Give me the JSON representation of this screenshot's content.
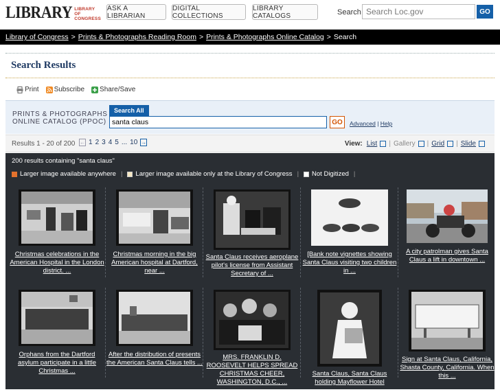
{
  "header": {
    "logo_text": "LIBRARY",
    "logo_sub": "LIBRARY OF CONGRESS",
    "buttons": [
      "ASK A LIBRARIAN",
      "DIGITAL COLLECTIONS",
      "LIBRARY CATALOGS"
    ],
    "search_label": "Search",
    "search_placeholder": "Search Loc.gov",
    "go": "GO"
  },
  "breadcrumb": {
    "items": [
      "Library of Congress",
      "Prints & Photographs Reading Room",
      "Prints & Photographs Online Catalog"
    ],
    "current": "Search",
    "sep": ">"
  },
  "page_title": "Search Results",
  "tools": {
    "print": "Print",
    "subscribe": "Subscribe",
    "share": "Share/Save"
  },
  "catalog": {
    "name_line1": "PRINTS & PHOTOGRAPHS",
    "name_line2": "ONLINE CATALOG (PPOC)",
    "tab": "Search All",
    "query": "santa claus",
    "go": "GO",
    "advanced": "Advanced",
    "help": "Help",
    "link_sep": "|"
  },
  "results": {
    "range": "Results 1 - 20 of 200",
    "pages": [
      "1",
      "2",
      "3",
      "4",
      "5",
      "...",
      "10"
    ],
    "view_label": "View:",
    "views": [
      "List",
      "Gallery",
      "Grid",
      "Slide"
    ],
    "summary": "200 results containing \"santa claus\"",
    "legend": [
      "Larger image available anywhere",
      "Larger image available only at the Library of Congress",
      "Not Digitized"
    ],
    "items": [
      {
        "caption": "Christmas celebrations in the American Hospital in the London district. ..."
      },
      {
        "caption": "Christmas morning in the big American hospital at Dartford, near ..."
      },
      {
        "caption": "Santa Claus receives aeroplane pilot's license from Assistant Secretary of ..."
      },
      {
        "caption": "[Bank note vignettes showing Santa Claus visiting two children in ..."
      },
      {
        "caption": "A city patrolman gives Santa Claus a lift in downtown ..."
      },
      {
        "caption": "Orphans from the Dartford asylum participate in a little Christmas ..."
      },
      {
        "caption": "After the distribution of presents the American Santa Claus tells ..."
      },
      {
        "caption": "MRS. FRANKLIN D. ROOSEVELT HELPS SPREAD CHRISTMAS CHEER, WASHINGTON, D.C., ..."
      },
      {
        "caption": "Santa Claus, Santa Claus holding Mayflower Hotel"
      },
      {
        "caption": "Sign at Santa Claus, California, Shasta County, California. When this ..."
      }
    ]
  },
  "colors": {
    "accent_blue": "#1560a8",
    "go_orange": "#d35400",
    "dark_bg": "#2a2e33",
    "title_navy": "#1f3a63"
  }
}
